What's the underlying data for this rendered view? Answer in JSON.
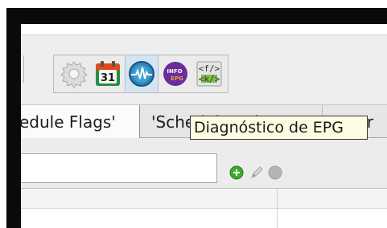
{
  "toolbar": {
    "buttons": [
      {
        "name": "settings",
        "icon": "gear-icon"
      },
      {
        "name": "schedule",
        "icon": "calendar-icon",
        "label": "31"
      },
      {
        "name": "diagnostics",
        "icon": "waveform-icon",
        "hovered": true
      },
      {
        "name": "epg-info",
        "icon": "info-epg-icon",
        "line1": "INFO",
        "line2": "EPG"
      },
      {
        "name": "markup",
        "icon": "tags-icon",
        "line1": "<f/>",
        "line2": "<k/>"
      }
    ]
  },
  "tabs": [
    {
      "label": "edule Flags'",
      "active": true
    },
    {
      "label": "'Schedule Values'"
    },
    {
      "label": "'Progr"
    }
  ],
  "tooltip": {
    "text": "Diagnóstico de EPG"
  },
  "filter": {
    "value": "",
    "placeholder": ""
  },
  "actions": {
    "add": {
      "icon": "add-icon",
      "color": "#3faa2e"
    },
    "edit": {
      "icon": "pencil-icon",
      "color": "#bdbdbd"
    },
    "remove": {
      "icon": "remove-icon",
      "color": "#b5b5b5"
    }
  }
}
